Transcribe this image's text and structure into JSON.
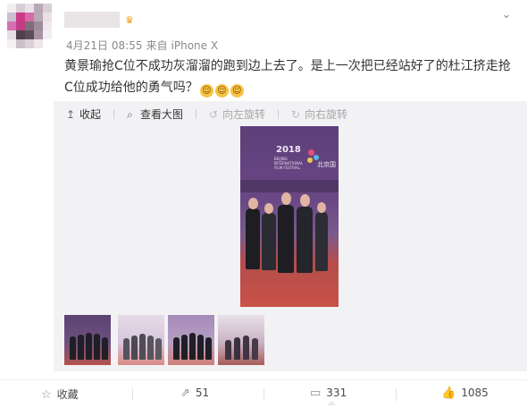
{
  "post": {
    "meta": {
      "date": "4月21日",
      "time": "08:55",
      "source_prefix": "来自",
      "source": "iPhone X"
    },
    "text": "黄景瑜抢C位不成功灰溜溜的跑到边上去了。是上一次把已经站好了的杜江挤走抢C位成功给他的勇气吗？",
    "emojis": [
      "laugh-cry-emoji",
      "laugh-cry-emoji",
      "laugh-cry-emoji"
    ],
    "icons": {
      "badge": "vip-crown-icon",
      "more": "chevron-down-icon"
    }
  },
  "media_toolbar": {
    "collapse": "收起",
    "view_large": "查看大图",
    "rotate_left": "向左旋转",
    "rotate_right": "向右旋转"
  },
  "photo": {
    "sign_text": "2018",
    "sign_sub": "BEIJING INTERNATIONAL FILM FESTIVAL",
    "sign_right": "北京国"
  },
  "thumbnails": [
    {
      "label": "thumbnail-1",
      "selected": true
    },
    {
      "label": "thumbnail-2",
      "selected": false
    },
    {
      "label": "thumbnail-3",
      "selected": false
    },
    {
      "label": "thumbnail-4",
      "selected": false
    }
  ],
  "actions": {
    "favorite": "收藏",
    "repost": "51",
    "comment": "331",
    "like": "1085"
  },
  "colors": {
    "accent": "#f08226",
    "media_background": "#f2f2f5",
    "carpet": "#c85248",
    "backdrop": "#6a4785"
  }
}
